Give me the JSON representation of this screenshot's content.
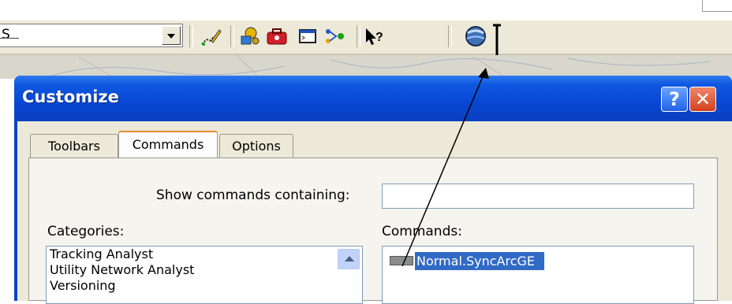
{
  "toolbar": {
    "combo_value": "S",
    "icons": [
      "editor-sketch-icon",
      "identify-tools-icon",
      "arctoolbox-icon",
      "command-line-icon",
      "model-builder-icon",
      "whats-this-help-icon",
      "sync-arcge-globe-icon"
    ]
  },
  "dialog": {
    "title": "Customize",
    "help_label": "?",
    "close_label": "✕",
    "tabs": [
      {
        "label": "Toolbars",
        "active": false
      },
      {
        "label": "Commands",
        "active": true
      },
      {
        "label": "Options",
        "active": false
      }
    ],
    "show_commands_label": "Show commands containing:",
    "show_commands_value": "",
    "categories_label": "Categories:",
    "categories": [
      "Tracking Analyst",
      "Utility Network Analyst",
      "Versioning"
    ],
    "commands_label": "Commands:",
    "commands": [
      "Normal.SyncArcGE"
    ]
  },
  "colors": {
    "title_blue": "#0847d4",
    "selection": "#316ac5",
    "dialog_bg": "#ece9d8"
  }
}
